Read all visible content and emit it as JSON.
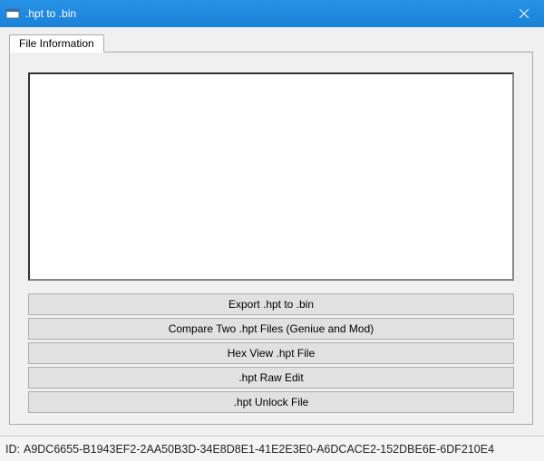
{
  "window": {
    "title": ".hpt to .bin"
  },
  "tabs": {
    "file_info": {
      "label": "File Information"
    }
  },
  "buttons": {
    "export": "Export .hpt to .bin",
    "compare": "Compare Two .hpt Files (Geniue and Mod)",
    "hexview": "Hex View .hpt File",
    "rawedit": ".hpt Raw Edit",
    "unlock": ".hpt Unlock File"
  },
  "status": {
    "id_label": "ID:",
    "id_value": "A9DC6655-B1943EF2-2AA50B3D-34E8D8E1-41E2E3E0-A6DCACE2-152DBE6E-6DF210E4"
  }
}
